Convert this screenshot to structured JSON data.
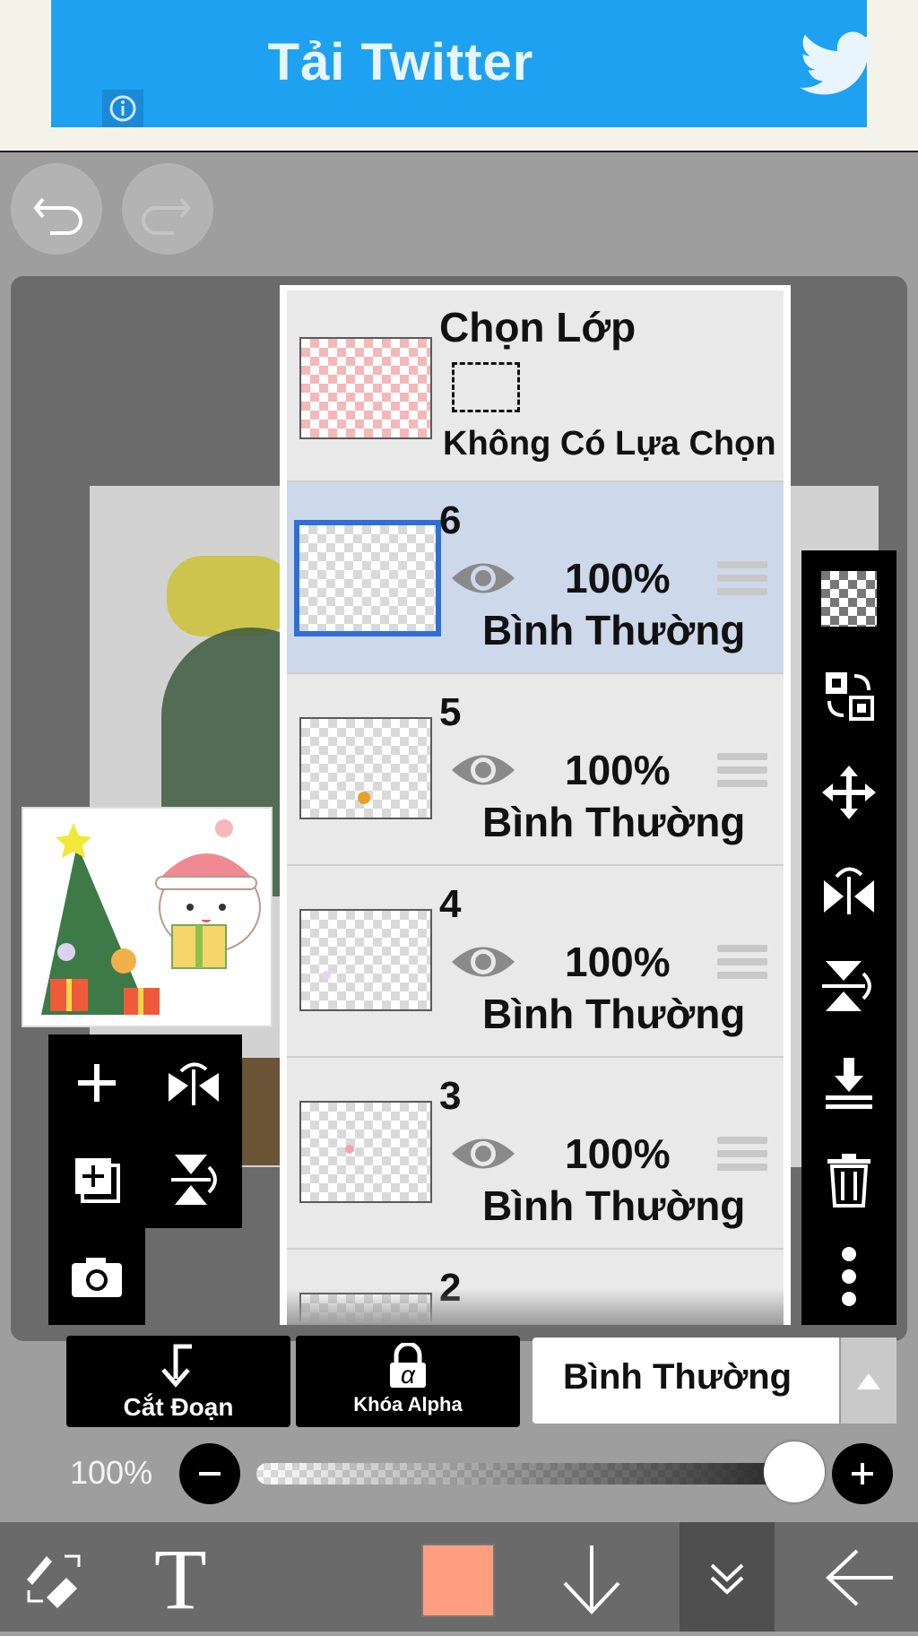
{
  "ad": {
    "text": "Tải Twitter",
    "icons": [
      "twitter-bird-icon",
      "info-icon"
    ],
    "color": "#1fa1f1"
  },
  "top_buttons": [
    "undo-icon",
    "redo-icon"
  ],
  "layer_panel": {
    "selection_layer": {
      "title": "Chọn Lớp",
      "status": "Không Có Lựa Chọn"
    },
    "layers": [
      {
        "number": "6",
        "opacity": "100%",
        "blend_mode": "Bình Thường",
        "selected": true
      },
      {
        "number": "5",
        "opacity": "100%",
        "blend_mode": "Bình Thường",
        "selected": false
      },
      {
        "number": "4",
        "opacity": "100%",
        "blend_mode": "Bình Thường",
        "selected": false
      },
      {
        "number": "3",
        "opacity": "100%",
        "blend_mode": "Bình Thường",
        "selected": false
      },
      {
        "number": "2",
        "opacity": "",
        "blend_mode": "",
        "selected": false
      }
    ],
    "selected_color": "#2e6fd6"
  },
  "right_toolbar": [
    "transparent-checker-icon",
    "swap-layer-icon",
    "move-icon",
    "flip-horizontal-icon",
    "flip-vertical-icon",
    "merge-down-icon",
    "trash-icon",
    "more-vertical-icon"
  ],
  "left_pad": [
    "add-layer-icon",
    "flip-layer-icon",
    "duplicate-layer-icon",
    "flip-layer-vertical-icon",
    "camera-icon"
  ],
  "bottom_controls": {
    "clip_label": "Cắt Đoạn",
    "alpha_lock_label": "Khóa Alpha",
    "alpha_glyph": "α",
    "blend_mode": "Bình Thường",
    "opacity_label": "100%",
    "opacity_value": 1.0
  },
  "bottom_nav": {
    "items": [
      "brush-eraser-swap-icon",
      "text-tool-icon",
      "color-swatch",
      "arrow-down-icon",
      "double-chevron-down-icon",
      "arrow-left-icon"
    ],
    "text_glyph": "T",
    "color": "#ff9f80"
  }
}
